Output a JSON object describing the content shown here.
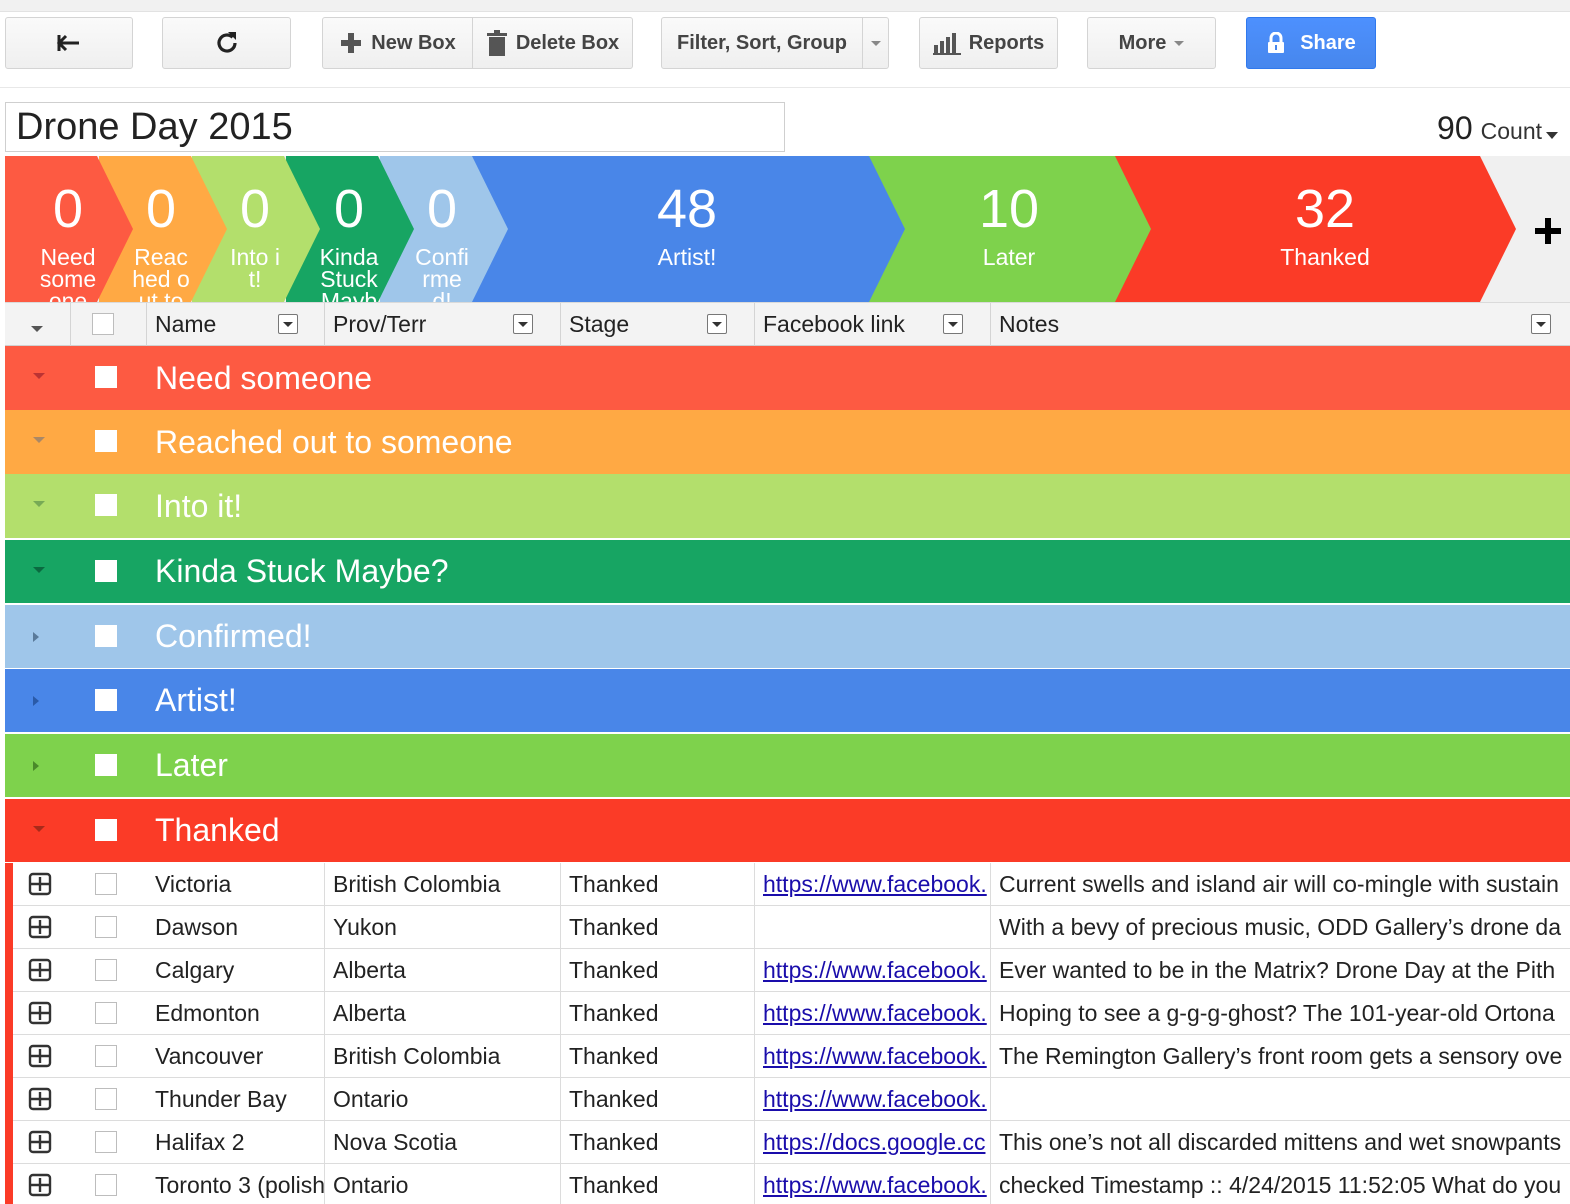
{
  "toolbar": {
    "back_icon": "back-arrow-icon",
    "refresh_icon": "refresh-icon",
    "new_box_label": "New Box",
    "delete_box_label": "Delete Box",
    "filter_label": "Filter, Sort, Group",
    "reports_label": "Reports",
    "more_label": "More",
    "share_label": "Share"
  },
  "pipeline_title": "Drone Day 2015",
  "count": {
    "value": "90",
    "label": "Count"
  },
  "stages": [
    {
      "count": "0",
      "name": "Need someone",
      "color": "#fd5a42"
    },
    {
      "count": "0",
      "name": "Reached out to someone",
      "color": "#ffa944"
    },
    {
      "count": "0",
      "name": "Into it!",
      "color": "#b3df6c"
    },
    {
      "count": "0",
      "name": "Kinda Stuck Maybe?",
      "color": "#17a563"
    },
    {
      "count": "0",
      "name": "Confirmed!",
      "color": "#9fc6ea"
    },
    {
      "count": "48",
      "name": "Artist!",
      "color": "#4986e8"
    },
    {
      "count": "10",
      "name": "Later",
      "color": "#7ed24c"
    },
    {
      "count": "32",
      "name": "Thanked",
      "color": "#fb3b27"
    }
  ],
  "columns": [
    "Name",
    "Prov/Terr",
    "Stage",
    "Facebook link",
    "Notes"
  ],
  "groups": [
    {
      "name": "Need someone",
      "expanded": true
    },
    {
      "name": "Reached out to someone",
      "expanded": true
    },
    {
      "name": "Into it!",
      "expanded": true
    },
    {
      "name": "Kinda Stuck Maybe?",
      "expanded": true
    },
    {
      "name": "Confirmed!",
      "expanded": false
    },
    {
      "name": "Artist!",
      "expanded": false
    },
    {
      "name": "Later",
      "expanded": false
    },
    {
      "name": "Thanked",
      "expanded": true
    }
  ],
  "rows": [
    {
      "name": "Victoria",
      "prov": "British Colombia",
      "stage": "Thanked",
      "link": "https://www.facebook.",
      "notes": "Current swells and island air will co-mingle with sustain"
    },
    {
      "name": "Dawson",
      "prov": "Yukon",
      "stage": "Thanked",
      "link": "",
      "notes": "With a bevy of precious music, ODD Gallery’s drone da"
    },
    {
      "name": "Calgary",
      "prov": "Alberta",
      "stage": "Thanked",
      "link": "https://www.facebook.",
      "notes": "Ever wanted to be in the Matrix? Drone Day at the Pith"
    },
    {
      "name": "Edmonton",
      "prov": "Alberta",
      "stage": "Thanked",
      "link": "https://www.facebook.",
      "notes": "Hoping to see a g-g-g-ghost? The 101-year-old Ortona"
    },
    {
      "name": "Vancouver",
      "prov": "British Colombia",
      "stage": "Thanked",
      "link": "https://www.facebook.",
      "notes": "The Remington Gallery’s front room gets a sensory ove"
    },
    {
      "name": "Thunder Bay",
      "prov": "Ontario",
      "stage": "Thanked",
      "link": "https://www.facebook.",
      "notes": ""
    },
    {
      "name": "Halifax 2",
      "prov": "Nova Scotia",
      "stage": "Thanked",
      "link": "https://docs.google.cc",
      "notes": "This one’s not all discarded mittens and wet snowpants"
    },
    {
      "name": "Toronto 3 (polish",
      "prov": "Ontario",
      "stage": "Thanked",
      "link": "https://www.facebook.",
      "notes": "checked Timestamp :: 4/24/2015 11:52:05 What do you"
    }
  ]
}
